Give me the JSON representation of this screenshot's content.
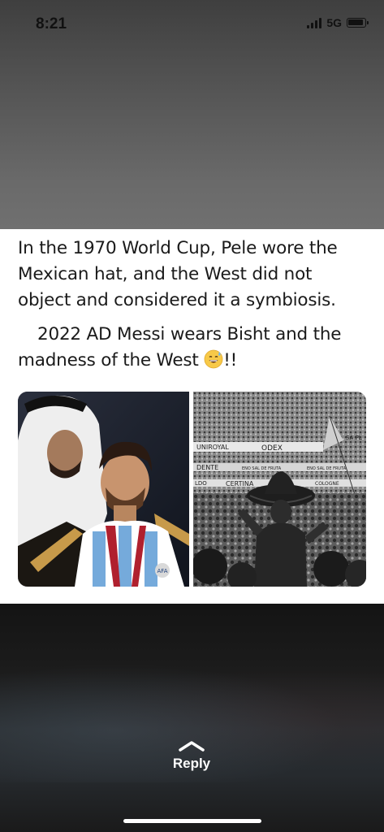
{
  "status_bar": {
    "time": "8:21",
    "network": "5G"
  },
  "post": {
    "paragraph1": "In the 1970 World Cup, Pele wore the Mexican hat, and the West did not object and considered it a symbiosis.",
    "paragraph2_main": "2022 AD Messi wears Bisht and the madness of the West",
    "paragraph2_end": "!!",
    "emoji_icon": "grinning-sweat-emoji-icon"
  },
  "images": {
    "left": {
      "icon": "photo-messi-bisht-icon",
      "jersey_badge": "AFA"
    },
    "right": {
      "icon": "photo-pele-sombrero-icon",
      "banners": [
        "UNIROYAL",
        "ODEX",
        "DENTE",
        "ENO SAL DE FRUTA",
        "ENO SAL DE FRUTA",
        "LDO",
        "CERTINA",
        "COLOGNE",
        "SA PL"
      ]
    }
  },
  "reply": {
    "label": "Reply",
    "icon": "chevron-up-icon"
  },
  "colors": {
    "card_background": "#ffffff",
    "text": "#1a1a1a",
    "reply_text": "#ffffff"
  }
}
